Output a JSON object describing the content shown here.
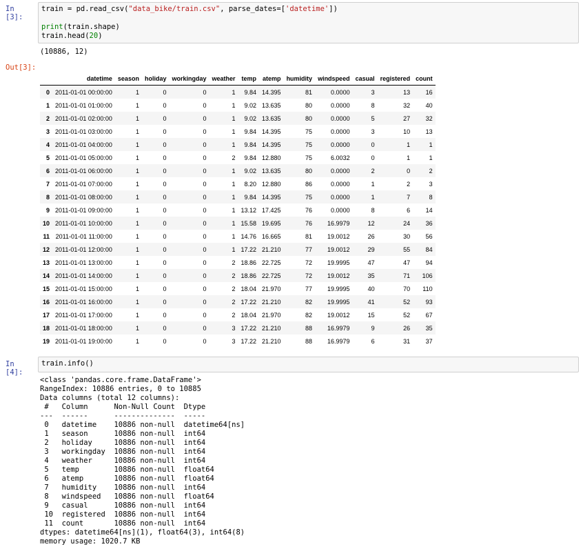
{
  "cells": {
    "c3": {
      "prompt": "In [3]:",
      "code": {
        "line1": {
          "a": "train = pd.read_csv(",
          "b": "\"data_bike/train.csv\"",
          "c": ", parse_dates=[",
          "d": "'datetime'",
          "e": "])"
        },
        "line3": {
          "a": "print",
          "b": "(train.shape)"
        },
        "line4": {
          "a": "train.head(",
          "b": "20",
          "c": ")"
        }
      },
      "stdout": "(10886, 12)",
      "out_prompt": "Out[3]:",
      "table": {
        "columns": [
          "datetime",
          "season",
          "holiday",
          "workingday",
          "weather",
          "temp",
          "atemp",
          "humidity",
          "windspeed",
          "casual",
          "registered",
          "count"
        ],
        "rows": [
          [
            "0",
            "2011-01-01 00:00:00",
            "1",
            "0",
            "0",
            "1",
            "9.84",
            "14.395",
            "81",
            "0.0000",
            "3",
            "13",
            "16"
          ],
          [
            "1",
            "2011-01-01 01:00:00",
            "1",
            "0",
            "0",
            "1",
            "9.02",
            "13.635",
            "80",
            "0.0000",
            "8",
            "32",
            "40"
          ],
          [
            "2",
            "2011-01-01 02:00:00",
            "1",
            "0",
            "0",
            "1",
            "9.02",
            "13.635",
            "80",
            "0.0000",
            "5",
            "27",
            "32"
          ],
          [
            "3",
            "2011-01-01 03:00:00",
            "1",
            "0",
            "0",
            "1",
            "9.84",
            "14.395",
            "75",
            "0.0000",
            "3",
            "10",
            "13"
          ],
          [
            "4",
            "2011-01-01 04:00:00",
            "1",
            "0",
            "0",
            "1",
            "9.84",
            "14.395",
            "75",
            "0.0000",
            "0",
            "1",
            "1"
          ],
          [
            "5",
            "2011-01-01 05:00:00",
            "1",
            "0",
            "0",
            "2",
            "9.84",
            "12.880",
            "75",
            "6.0032",
            "0",
            "1",
            "1"
          ],
          [
            "6",
            "2011-01-01 06:00:00",
            "1",
            "0",
            "0",
            "1",
            "9.02",
            "13.635",
            "80",
            "0.0000",
            "2",
            "0",
            "2"
          ],
          [
            "7",
            "2011-01-01 07:00:00",
            "1",
            "0",
            "0",
            "1",
            "8.20",
            "12.880",
            "86",
            "0.0000",
            "1",
            "2",
            "3"
          ],
          [
            "8",
            "2011-01-01 08:00:00",
            "1",
            "0",
            "0",
            "1",
            "9.84",
            "14.395",
            "75",
            "0.0000",
            "1",
            "7",
            "8"
          ],
          [
            "9",
            "2011-01-01 09:00:00",
            "1",
            "0",
            "0",
            "1",
            "13.12",
            "17.425",
            "76",
            "0.0000",
            "8",
            "6",
            "14"
          ],
          [
            "10",
            "2011-01-01 10:00:00",
            "1",
            "0",
            "0",
            "1",
            "15.58",
            "19.695",
            "76",
            "16.9979",
            "12",
            "24",
            "36"
          ],
          [
            "11",
            "2011-01-01 11:00:00",
            "1",
            "0",
            "0",
            "1",
            "14.76",
            "16.665",
            "81",
            "19.0012",
            "26",
            "30",
            "56"
          ],
          [
            "12",
            "2011-01-01 12:00:00",
            "1",
            "0",
            "0",
            "1",
            "17.22",
            "21.210",
            "77",
            "19.0012",
            "29",
            "55",
            "84"
          ],
          [
            "13",
            "2011-01-01 13:00:00",
            "1",
            "0",
            "0",
            "2",
            "18.86",
            "22.725",
            "72",
            "19.9995",
            "47",
            "47",
            "94"
          ],
          [
            "14",
            "2011-01-01 14:00:00",
            "1",
            "0",
            "0",
            "2",
            "18.86",
            "22.725",
            "72",
            "19.0012",
            "35",
            "71",
            "106"
          ],
          [
            "15",
            "2011-01-01 15:00:00",
            "1",
            "0",
            "0",
            "2",
            "18.04",
            "21.970",
            "77",
            "19.9995",
            "40",
            "70",
            "110"
          ],
          [
            "16",
            "2011-01-01 16:00:00",
            "1",
            "0",
            "0",
            "2",
            "17.22",
            "21.210",
            "82",
            "19.9995",
            "41",
            "52",
            "93"
          ],
          [
            "17",
            "2011-01-01 17:00:00",
            "1",
            "0",
            "0",
            "2",
            "18.04",
            "21.970",
            "82",
            "19.0012",
            "15",
            "52",
            "67"
          ],
          [
            "18",
            "2011-01-01 18:00:00",
            "1",
            "0",
            "0",
            "3",
            "17.22",
            "21.210",
            "88",
            "16.9979",
            "9",
            "26",
            "35"
          ],
          [
            "19",
            "2011-01-01 19:00:00",
            "1",
            "0",
            "0",
            "3",
            "17.22",
            "21.210",
            "88",
            "16.9979",
            "6",
            "31",
            "37"
          ]
        ]
      }
    },
    "c4": {
      "prompt": "In [4]:",
      "code": "train.info()",
      "output_lines": [
        "<class 'pandas.core.frame.DataFrame'>",
        "RangeIndex: 10886 entries, 0 to 10885",
        "Data columns (total 12 columns):",
        " #   Column      Non-Null Count  Dtype         ",
        "---  ------      --------------  -----         ",
        " 0   datetime    10886 non-null  datetime64[ns]",
        " 1   season      10886 non-null  int64         ",
        " 2   holiday     10886 non-null  int64         ",
        " 3   workingday  10886 non-null  int64         ",
        " 4   weather     10886 non-null  int64         ",
        " 5   temp        10886 non-null  float64       ",
        " 6   atemp       10886 non-null  float64       ",
        " 7   humidity    10886 non-null  int64         ",
        " 8   windspeed   10886 non-null  float64       ",
        " 9   casual      10886 non-null  int64         ",
        " 10  registered  10886 non-null  int64         ",
        " 11  count       10886 non-null  int64         ",
        "dtypes: datetime64[ns](1), float64(3), int64(8)",
        "memory usage: 1020.7 KB"
      ]
    }
  }
}
